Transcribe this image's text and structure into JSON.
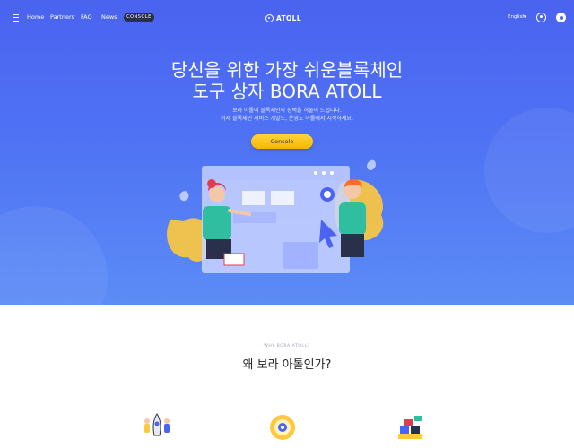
{
  "nav": {
    "home": "Home",
    "partners": "Partners",
    "faq": "FAQ",
    "news": "News",
    "console": "CONSOLE",
    "logo_text": "ATOLL",
    "language": "English"
  },
  "hero": {
    "title_line1": "당신을 위한 가장 쉬운블록체인",
    "title_line2": "도구 상자 BORA ATOLL",
    "subtitle_line1": "보라 아톨이 블록체인의 장벽을 허물어 드립니다.",
    "subtitle_line2": "이제 블록체인 서비스 개발도, 운영도 아톨에서 시작하세요.",
    "cta_label": "Console"
  },
  "why": {
    "eyebrow": "WHY BORA ATOLL?",
    "title": "왜 보라 아톨인가?"
  },
  "colors": {
    "hero_top": "#4a63f0",
    "hero_bottom": "#5c8cf6",
    "cta": "#ffd43b",
    "console_btn": "#2a2f4a"
  },
  "icons": [
    "menu-icon",
    "atoll-logo-icon",
    "user-icon",
    "dot-icon",
    "rocket-team-icon",
    "coin-cycle-icon",
    "blocks-icon"
  ]
}
